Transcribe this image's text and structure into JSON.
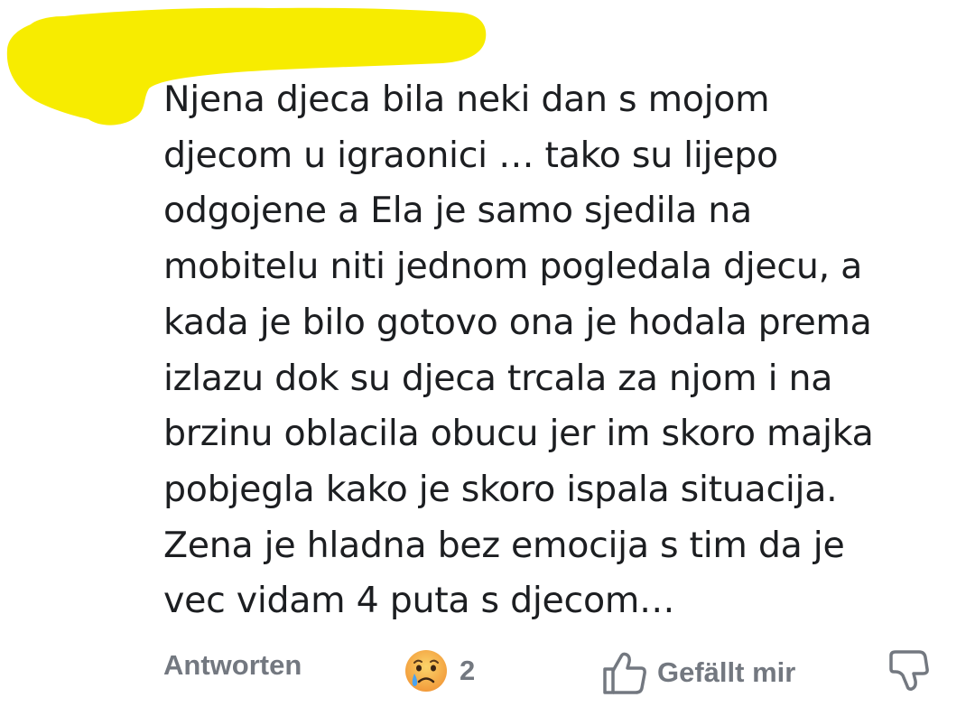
{
  "comment": {
    "lines": [
      "Njena djeca bila neki dan s mojom",
      "djecom u igraonici … tako su lijepo",
      "odgojene a Ela je samo sjedila na",
      "mobitelu niti jednom pogledala djecu, a",
      "kada je bilo gotovo ona je hodala prema",
      "izlazu dok su djeca trcala za njom i na",
      "brzinu oblacila obucu jer im skoro majka",
      "pobjegla kako je skoro ispala situacija.",
      "Zena je hladna bez emocija s tim da je",
      "vec vidam 4 puta s djecom…"
    ]
  },
  "actions": {
    "reply_label": "Antworten",
    "reaction_icon": "sad-crying-face-icon",
    "reaction_count": "2",
    "like_label": "Gefällt mir",
    "like_icon": "thumbs-up-icon",
    "dislike_icon": "thumbs-down-icon"
  },
  "colors": {
    "text": "#1c1e21",
    "muted": "#737880",
    "highlight": "#f7ec00",
    "emoji_face": "#f7b84b",
    "tear": "#4aa3f0"
  }
}
